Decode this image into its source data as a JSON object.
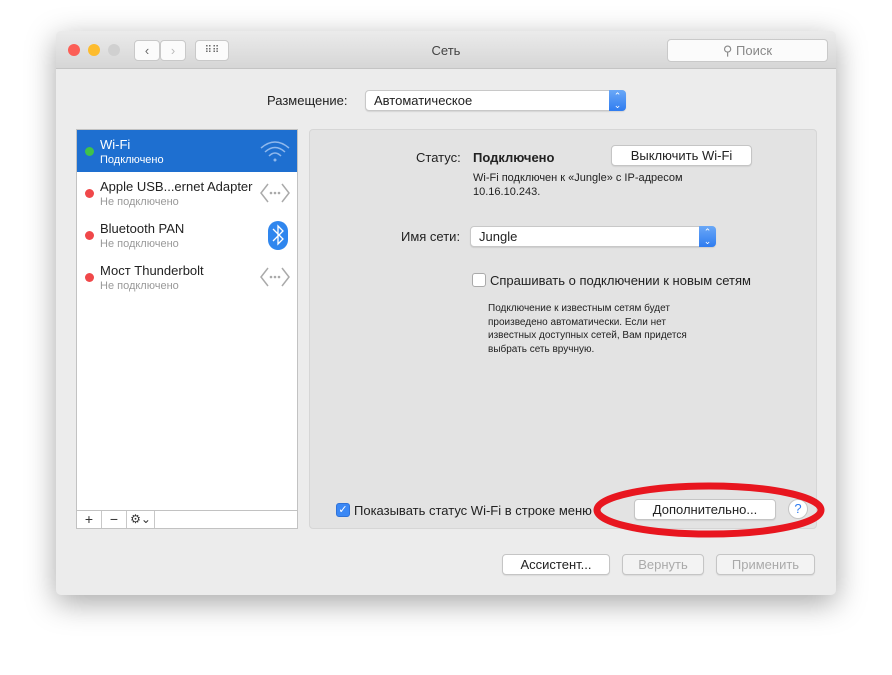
{
  "window": {
    "title": "Сеть",
    "search_placeholder": "Поиск"
  },
  "location": {
    "label": "Размещение:",
    "value": "Автоматическое"
  },
  "services": [
    {
      "name": "Wi-Fi",
      "status": "Подключено",
      "status_color": "#3fc24a",
      "icon": "wifi-icon",
      "selected": true
    },
    {
      "name": "Apple USB...ernet Adapter",
      "status": "Не подключено",
      "status_color": "#f0484a",
      "icon": "ethernet-icon"
    },
    {
      "name": "Bluetooth PAN",
      "status": "Не подключено",
      "status_color": "#f0484a",
      "icon": "bluetooth-icon"
    },
    {
      "name": "Мост Thunderbolt",
      "status": "Не подключено",
      "status_color": "#f0484a",
      "icon": "ethernet-icon"
    }
  ],
  "list_toolbar": {
    "add": "+",
    "remove": "−",
    "gear": "⚙⌄"
  },
  "detail": {
    "status_label": "Статус:",
    "status_value": "Подключено",
    "turn_off_button": "Выключить Wi-Fi",
    "status_desc_1": "Wi-Fi подключен к «Jungle» с IP-адресом",
    "status_desc_2": "10.16.10.243.",
    "network_label": "Имя сети:",
    "network_value": "Jungle",
    "ask_label": "Спрашивать о подключении к новым сетям",
    "ask_checked": false,
    "ask_desc": [
      "Подключение к известным сетям будет",
      "произведено автоматически. Если нет",
      "известных доступных сетей, Вам придется",
      "выбрать сеть вручную."
    ],
    "show_status_label": "Показывать статус Wi-Fi в строке меню",
    "show_status_checked": true,
    "advanced_button": "Дополнительно...",
    "help": "?"
  },
  "footer": {
    "assistant": "Ассистент...",
    "revert": "Вернуть",
    "apply": "Применить"
  },
  "annotation_color": "#e8161f"
}
